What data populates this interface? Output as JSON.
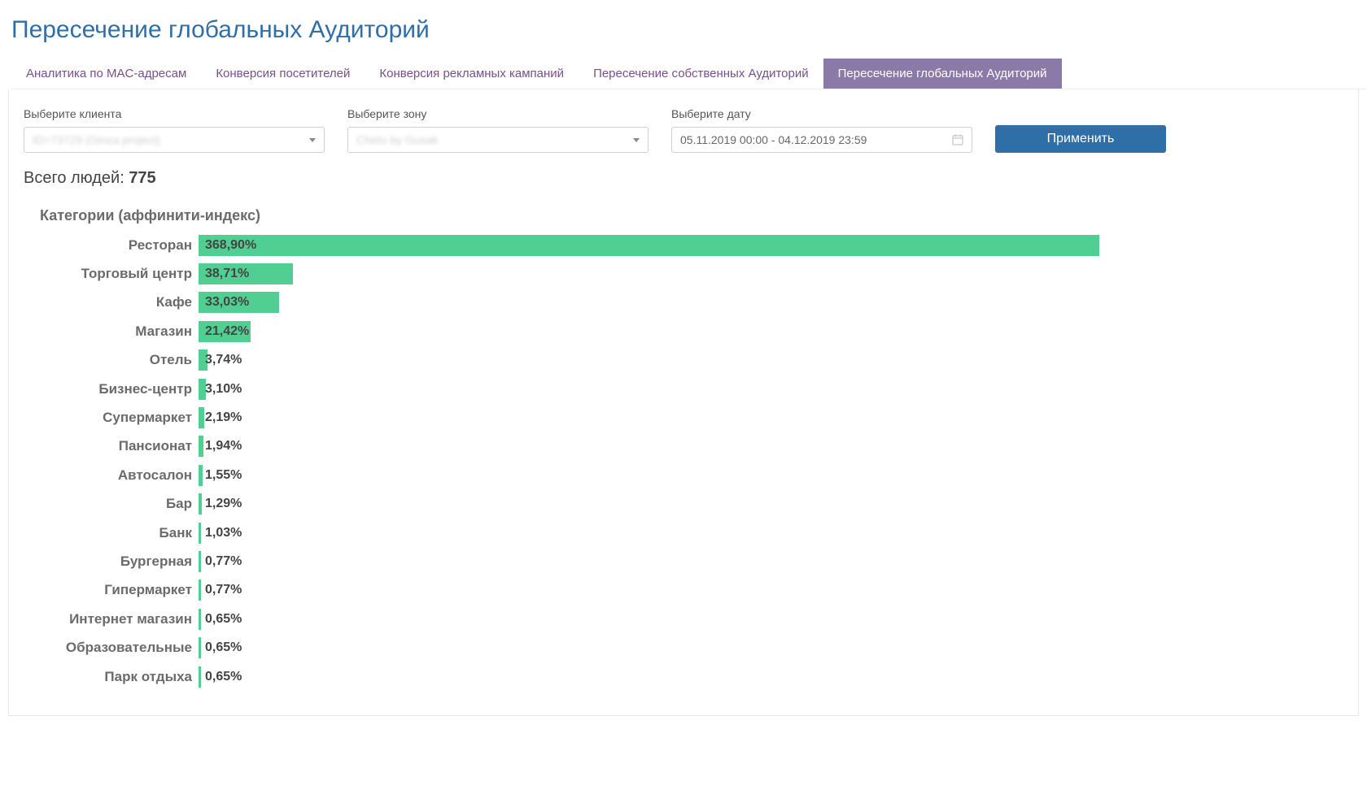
{
  "page_title": "Пересечение глобальных Аудиторий",
  "tabs": [
    {
      "label": "Аналитика по MAC-адресам",
      "active": false
    },
    {
      "label": "Конверсия посетителей",
      "active": false
    },
    {
      "label": "Конверсия рекламных кампаний",
      "active": false
    },
    {
      "label": "Пересечение собственных Аудиторий",
      "active": false
    },
    {
      "label": "Пересечение глобальных Аудиторий",
      "active": true
    }
  ],
  "filters": {
    "client_label": "Выберите клиента",
    "client_value": "ID=73729 (Ginza project)",
    "zone_label": "Выберите зону",
    "zone_value": "Cheto by Gusak",
    "date_label": "Выберите дату",
    "date_value": "05.11.2019 00:00 - 04.12.2019 23:59",
    "apply_label": "Применить"
  },
  "total": {
    "label": "Всего людей: ",
    "value": "775"
  },
  "chart_title": "Категории (аффинити-индекс)",
  "chart_data": {
    "type": "bar",
    "orientation": "horizontal",
    "xlabel": "",
    "ylabel": "",
    "title": "Категории (аффинити-индекс)",
    "max_for_scale": 368.9,
    "categories": [
      "Ресторан",
      "Торговый центр",
      "Кафе",
      "Магазин",
      "Отель",
      "Бизнес-центр",
      "Супермаркет",
      "Пансионат",
      "Автосалон",
      "Бар",
      "Банк",
      "Бургерная",
      "Гипермаркет",
      "Интернет магазин",
      "Образовательные",
      "Парк отдыха"
    ],
    "values": [
      368.9,
      38.71,
      33.03,
      21.42,
      3.74,
      3.1,
      2.19,
      1.94,
      1.55,
      1.29,
      1.03,
      0.77,
      0.77,
      0.65,
      0.65,
      0.65
    ],
    "display_values": [
      "368,90%",
      "38,71%",
      "33,03%",
      "21,42%",
      "3,74%",
      "3,10%",
      "2,19%",
      "1,94%",
      "1,55%",
      "1,29%",
      "1,03%",
      "0,77%",
      "0,77%",
      "0,65%",
      "0,65%",
      "0,65%"
    ]
  }
}
